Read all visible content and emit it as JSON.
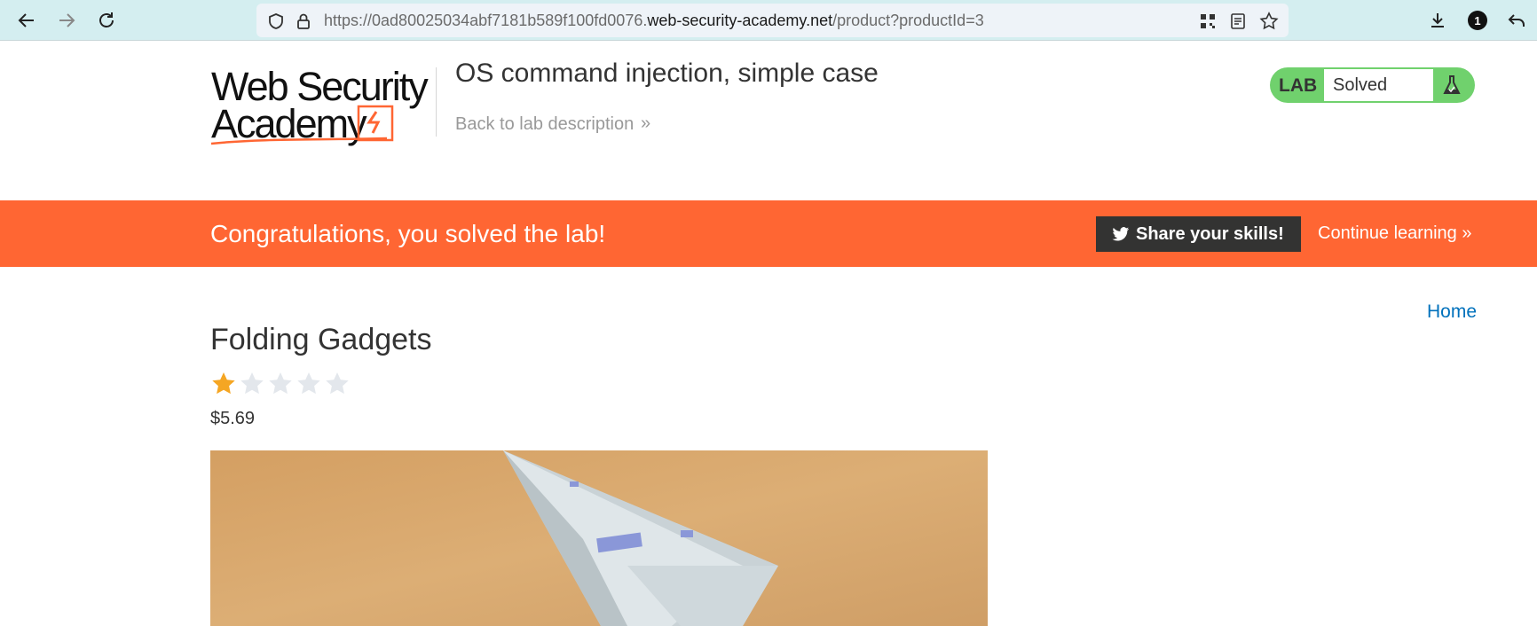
{
  "browser": {
    "url_prefix": "https://0ad80025034abf7181b589f100fd0076.",
    "url_host": "web-security-academy.net",
    "url_path": "/product?productId=3",
    "notification_count": "1"
  },
  "header": {
    "logo_line1": "Web Security",
    "logo_line2": "Academy",
    "lab_title": "OS command injection, simple case",
    "back_link": "Back to lab description",
    "lab_badge": "LAB",
    "lab_status": "Solved"
  },
  "banner": {
    "message": "Congratulations, you solved the lab!",
    "share_label": "Share your skills!",
    "continue_label": "Continue learning"
  },
  "main": {
    "home_link": "Home",
    "product_name": "Folding Gadgets",
    "rating": 1,
    "rating_max": 5,
    "price": "$5.69"
  },
  "colors": {
    "accent_orange": "#ff6633",
    "lab_green": "#70d16d",
    "star_filled": "#f5a623",
    "star_empty": "#e3e7ec",
    "link_blue": "#0071bc"
  }
}
